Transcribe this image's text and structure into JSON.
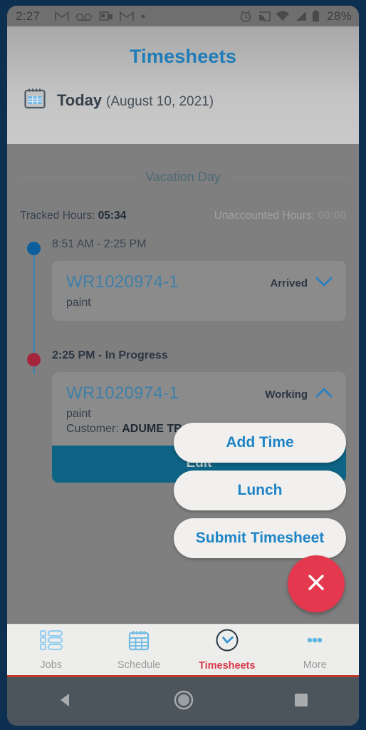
{
  "status_bar": {
    "time": "2:27",
    "left_icons": [
      "gmail-icon",
      "voicemail-icon",
      "outlook-icon",
      "gmail-icon",
      "dot-icon"
    ],
    "right_icons": [
      "alarm-icon",
      "cast-icon",
      "wifi-icon",
      "cellular-signal-icon",
      "battery-icon"
    ],
    "battery_percent": "28%"
  },
  "header": {
    "title": "Timesheets",
    "calendar_icon": "calendar-icon",
    "today_label": "Today",
    "today_date": "(August 10, 2021)"
  },
  "day": {
    "divider_label": "Vacation Day",
    "tracked_hours_label": "Tracked Hours:",
    "tracked_hours_value": "05:34",
    "unaccounted_hours_label": "Unaccounted Hours:",
    "unaccounted_hours_value": "00:00"
  },
  "entries": [
    {
      "dot_color": "#0d5e9d",
      "time_range": "8:51 AM - 2:25 PM",
      "work_order": "WR1020974-1",
      "description": "paint",
      "status": "Arrived",
      "chevron": "chevron-down-icon"
    },
    {
      "dot_color": "#a5253a",
      "time_range": "2:25 PM - In Progress",
      "work_order": "WR1020974-1",
      "description": "paint",
      "customer_label": "Customer:",
      "customer_value": "ADUME TR",
      "status": "Working",
      "chevron": "chevron-up-icon",
      "edit_label": "Edit"
    }
  ],
  "fab_menu": {
    "items": [
      {
        "label": "Add Time"
      },
      {
        "label": "Lunch"
      },
      {
        "label": "Submit Timesheet"
      }
    ],
    "close_icon": "close-icon",
    "close_color": "#e4384f"
  },
  "bottom_nav": {
    "items": [
      {
        "label": "Jobs",
        "icon": "jobs-list-icon",
        "active": false
      },
      {
        "label": "Schedule",
        "icon": "calendar-icon",
        "active": false
      },
      {
        "label": "Timesheets",
        "icon": "clock-icon",
        "active": true
      },
      {
        "label": "More",
        "icon": "more-dots-icon",
        "active": false
      }
    ]
  },
  "android_nav": {
    "back": "back-triangle-icon",
    "home": "home-circle-icon",
    "recents": "recents-square-icon"
  },
  "colors": {
    "accent_blue": "#1f84c6",
    "title_blue": "#1f7cb8",
    "active_red": "#d9394a",
    "edit_teal": "#0e6485"
  }
}
